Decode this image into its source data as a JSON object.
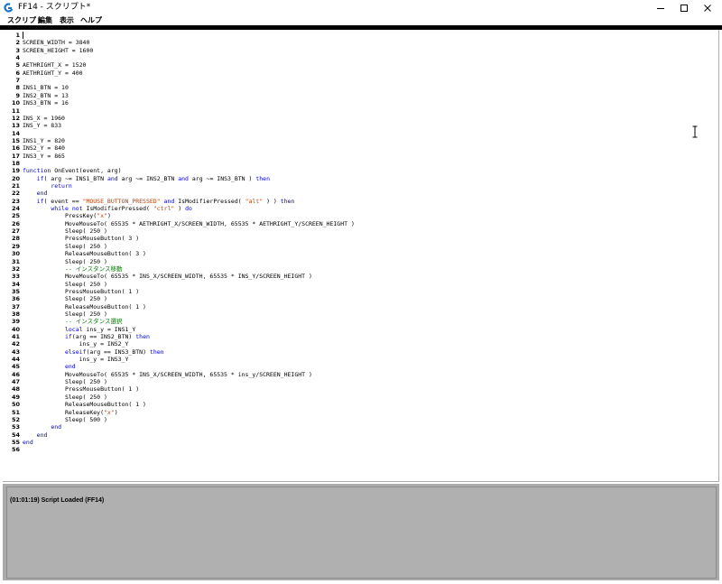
{
  "window": {
    "title": "FF14 - スクリプト*",
    "minimize_glyph": "─",
    "maximize_glyph": "☐",
    "close_glyph": "✕"
  },
  "menu": [
    "スクリプト",
    "編集",
    "表示",
    "ヘルプ"
  ],
  "editor": {
    "lines": [
      [],
      [
        [
          "t",
          "SCREEN_WIDTH = 3840"
        ]
      ],
      [
        [
          "t",
          "SCREEN_HEIGHT = 1600"
        ]
      ],
      [],
      [
        [
          "t",
          "AETHRIGHT_X = 1520"
        ]
      ],
      [
        [
          "t",
          "AETHRIGHT_Y = 400"
        ]
      ],
      [],
      [
        [
          "t",
          "INS1_BTN = 10"
        ]
      ],
      [
        [
          "t",
          "INS2_BTN = 13"
        ]
      ],
      [
        [
          "t",
          "INS3_BTN = 16"
        ]
      ],
      [],
      [
        [
          "t",
          "INS_X = 1960"
        ]
      ],
      [
        [
          "t",
          "INS_Y = 833"
        ]
      ],
      [],
      [
        [
          "t",
          "INS1_Y = 820"
        ]
      ],
      [
        [
          "t",
          "INS2_Y = 840"
        ]
      ],
      [
        [
          "t",
          "INS3_Y = 865"
        ]
      ],
      [],
      [
        [
          "k",
          "function"
        ],
        [
          "t",
          " OnEvent(event, arg)"
        ]
      ],
      [
        [
          "t",
          "    "
        ],
        [
          "k",
          "if"
        ],
        [
          "t",
          "( arg ~= INS1_BTN "
        ],
        [
          "k",
          "and"
        ],
        [
          "t",
          " arg ~= INS2_BTN "
        ],
        [
          "k",
          "and"
        ],
        [
          "t",
          " arg ~= INS3_BTN ) "
        ],
        [
          "k",
          "then"
        ]
      ],
      [
        [
          "t",
          "        "
        ],
        [
          "k",
          "return"
        ]
      ],
      [
        [
          "t",
          "    "
        ],
        [
          "k",
          "end"
        ]
      ],
      [
        [
          "t",
          "    "
        ],
        [
          "k",
          "if"
        ],
        [
          "t",
          "( event == "
        ],
        [
          "s",
          "\"MOUSE_BUTTON_PRESSED\""
        ],
        [
          "t",
          " "
        ],
        [
          "k",
          "and"
        ],
        [
          "t",
          " IsModifierPressed( "
        ],
        [
          "s",
          "\"alt\""
        ],
        [
          "t",
          " ) ) "
        ],
        [
          "k",
          "then"
        ]
      ],
      [
        [
          "t",
          "        "
        ],
        [
          "k",
          "while"
        ],
        [
          "t",
          " "
        ],
        [
          "k",
          "not"
        ],
        [
          "t",
          " IsModifierPressed( "
        ],
        [
          "s",
          "\"ctrl\""
        ],
        [
          "t",
          " ) "
        ],
        [
          "k",
          "do"
        ]
      ],
      [
        [
          "t",
          "            PressKey("
        ],
        [
          "s",
          "\"x\""
        ],
        [
          "t",
          ")"
        ]
      ],
      [
        [
          "t",
          "            MoveMouseTo( 65535 * AETHRIGHT_X/SCREEN_WIDTH, 65535 * AETHRIGHT_Y/SCREEN_HEIGHT )"
        ]
      ],
      [
        [
          "t",
          "            Sleep( 250 )"
        ]
      ],
      [
        [
          "t",
          "            PressMouseButton( 3 )"
        ]
      ],
      [
        [
          "t",
          "            Sleep( 250 )"
        ]
      ],
      [
        [
          "t",
          "            ReleaseMouseButton( 3 )"
        ]
      ],
      [
        [
          "t",
          "            Sleep( 250 )"
        ]
      ],
      [
        [
          "t",
          "            "
        ],
        [
          "c",
          "-- インスタンス移動"
        ]
      ],
      [
        [
          "t",
          "            MoveMouseTo( 65535 * INS_X/SCREEN_WIDTH, 65535 * INS_Y/SCREEN_HEIGHT )"
        ]
      ],
      [
        [
          "t",
          "            Sleep( 250 )"
        ]
      ],
      [
        [
          "t",
          "            PressMouseButton( 1 )"
        ]
      ],
      [
        [
          "t",
          "            Sleep( 250 )"
        ]
      ],
      [
        [
          "t",
          "            ReleaseMouseButton( 1 )"
        ]
      ],
      [
        [
          "t",
          "            Sleep( 250 )"
        ]
      ],
      [
        [
          "t",
          "            "
        ],
        [
          "c",
          "-- インスタンス選択"
        ]
      ],
      [
        [
          "t",
          "            "
        ],
        [
          "k",
          "local"
        ],
        [
          "t",
          " ins_y = INS1_Y"
        ]
      ],
      [
        [
          "t",
          "            "
        ],
        [
          "k",
          "if"
        ],
        [
          "t",
          "(arg == INS2_BTN) "
        ],
        [
          "k",
          "then"
        ]
      ],
      [
        [
          "t",
          "                ins_y = INS2_Y"
        ]
      ],
      [
        [
          "t",
          "            "
        ],
        [
          "k",
          "elseif"
        ],
        [
          "t",
          "(arg == INS3_BTN) "
        ],
        [
          "k",
          "then"
        ]
      ],
      [
        [
          "t",
          "                ins_y = INS3_Y"
        ]
      ],
      [
        [
          "t",
          "            "
        ],
        [
          "k",
          "end"
        ]
      ],
      [
        [
          "t",
          "            MoveMouseTo( 65535 * INS_X/SCREEN_WIDTH, 65535 * ins_y/SCREEN_HEIGHT )"
        ]
      ],
      [
        [
          "t",
          "            Sleep( 250 )"
        ]
      ],
      [
        [
          "t",
          "            PressMouseButton( 1 )"
        ]
      ],
      [
        [
          "t",
          "            Sleep( 250 )"
        ]
      ],
      [
        [
          "t",
          "            ReleaseMouseButton( 1 )"
        ]
      ],
      [
        [
          "t",
          "            ReleaseKey("
        ],
        [
          "s",
          "\"x\""
        ],
        [
          "t",
          ")"
        ]
      ],
      [
        [
          "t",
          "            Sleep( 500 )"
        ]
      ],
      [
        [
          "t",
          "        "
        ],
        [
          "k",
          "end"
        ]
      ],
      [
        [
          "t",
          "    "
        ],
        [
          "k",
          "end"
        ]
      ],
      [
        [
          "k",
          "end"
        ]
      ],
      []
    ]
  },
  "log": {
    "line": "(01:01:19) Script Loaded (FF14)"
  },
  "colors": {
    "keyword": "#0000dd",
    "string": "#b8400a",
    "comment": "#007a00",
    "accent_icon": "#1a73c9"
  }
}
